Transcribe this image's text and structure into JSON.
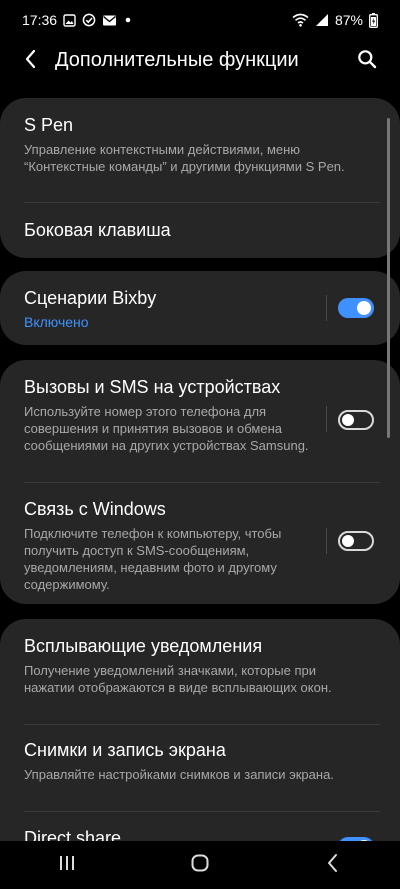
{
  "status_bar": {
    "time": "17:36",
    "battery": "87%",
    "icons": [
      "gallery-icon",
      "check-circle-icon",
      "mail-icon",
      "dot-icon",
      "wifi-icon",
      "signal-icon",
      "battery-icon"
    ]
  },
  "header": {
    "title": "Дополнительные функции"
  },
  "sections": {
    "spen": {
      "title": "S Pen",
      "desc": "Управление контекстными действиями, меню “Контекстные команды” и другими функциями S Pen."
    },
    "side_key": {
      "title": "Боковая клавиша"
    },
    "bixby": {
      "title": "Сценарии Bixby",
      "status": "Включено",
      "enabled": true
    },
    "calls": {
      "title": "Вызовы и SMS на устройствах",
      "desc": "Используйте номер этого телефона для совершения и принятия вызовов и обмена сообщениями на других устройствах Samsung.",
      "enabled": false
    },
    "windows": {
      "title": "Связь с Windows",
      "desc": "Подключите телефон к компьютеру, чтобы получить доступ к SMS-сообщениям, уведомлениям, недавним фото и другому содержимому.",
      "enabled": false
    },
    "bubbles": {
      "title": "Всплывающие уведомления",
      "desc": "Получение уведомлений значками, которые при нажатии отображаются в виде всплывающих окон."
    },
    "screenshots": {
      "title": "Снимки и запись экрана",
      "desc": "Управляйте настройками снимков и записи экрана."
    },
    "direct_share": {
      "title": "Direct share",
      "enabled": true
    }
  },
  "colors": {
    "accent": "#3e91ff",
    "card": "#262626",
    "background": "#000000"
  }
}
